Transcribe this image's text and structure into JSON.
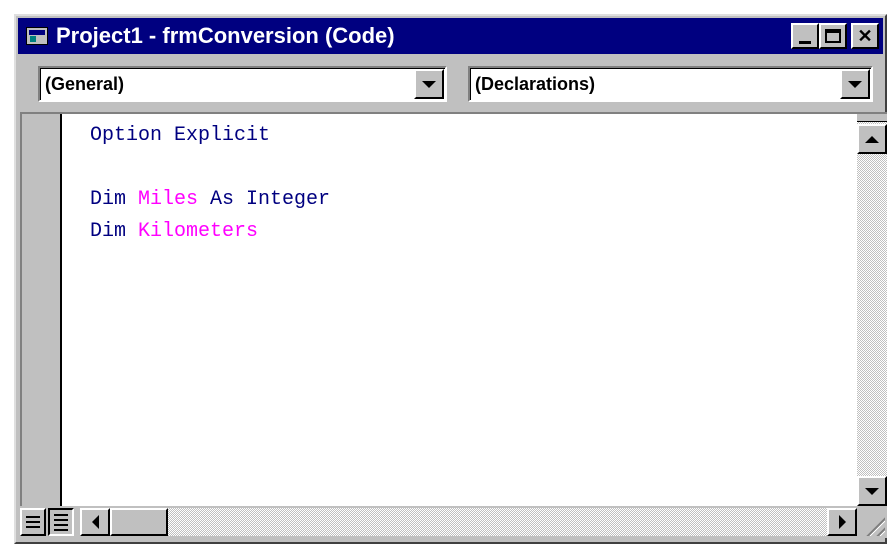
{
  "window": {
    "title": "Project1 - frmConversion (Code)"
  },
  "titlebar": {
    "buttons": [
      "minimize",
      "maximize",
      "close"
    ]
  },
  "combos": {
    "object": {
      "value": "(General)"
    },
    "procedure": {
      "value": "(Declarations)"
    }
  },
  "code": {
    "lines": [
      [
        {
          "text": "Option Explicit",
          "kind": "keyword"
        }
      ],
      [],
      [
        {
          "text": "Dim ",
          "kind": "keyword"
        },
        {
          "text": "Miles",
          "kind": "identifier"
        },
        {
          "text": " As Integer",
          "kind": "keyword"
        }
      ],
      [
        {
          "text": "Dim ",
          "kind": "keyword"
        },
        {
          "text": "Kilometers",
          "kind": "identifier"
        }
      ]
    ]
  },
  "colors": {
    "titlebar": "#000080",
    "keyword": "#000080",
    "identifier": "#ff00ff",
    "face": "#c0c0c0"
  },
  "views": {
    "procedure_view": "procedure-view",
    "full_module_view": "full-module-view"
  }
}
